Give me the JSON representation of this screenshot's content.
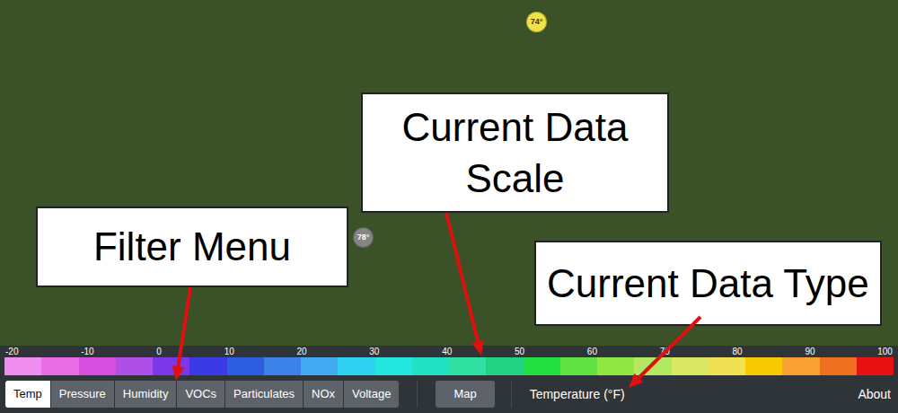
{
  "map": {
    "pins": [
      {
        "label": "74°",
        "color": "#f2e24a"
      },
      {
        "label": "78°",
        "color": "#858585"
      }
    ]
  },
  "annotations": [
    {
      "text": "Filter Menu"
    },
    {
      "text": "Current Data Scale"
    },
    {
      "text": "Current Data Type"
    }
  ],
  "scale": {
    "ticks": [
      "-20",
      "-10",
      "0",
      "10",
      "20",
      "30",
      "40",
      "50",
      "60",
      "70",
      "80",
      "90",
      "100"
    ],
    "segments": [
      {
        "color": "#f08ef0"
      },
      {
        "color": "#e86ee8"
      },
      {
        "color": "#d650e0"
      },
      {
        "color": "#b04ee8"
      },
      {
        "color": "#7a38e8"
      },
      {
        "color": "#3a3ae6"
      },
      {
        "color": "#2e5ee0"
      },
      {
        "color": "#3a82e8"
      },
      {
        "color": "#42aaf0"
      },
      {
        "color": "#30d0f0"
      },
      {
        "color": "#22e8e0"
      },
      {
        "color": "#22e0c2"
      },
      {
        "color": "#30e0a2"
      },
      {
        "color": "#22d282"
      },
      {
        "color": "#22e042"
      },
      {
        "color": "#62e242"
      },
      {
        "color": "#92e842"
      },
      {
        "color": "#b2e862"
      },
      {
        "color": "#d8e862"
      },
      {
        "color": "#f0e052"
      },
      {
        "color": "#f8c802"
      },
      {
        "color": "#f8a032"
      },
      {
        "color": "#f07022"
      },
      {
        "color": "#e81212"
      }
    ]
  },
  "filters": [
    {
      "label": "Temp",
      "selected": true
    },
    {
      "label": "Pressure",
      "selected": false
    },
    {
      "label": "Humidity",
      "selected": false
    },
    {
      "label": "VOCs",
      "selected": false
    },
    {
      "label": "Particulates",
      "selected": false
    },
    {
      "label": "NOx",
      "selected": false
    },
    {
      "label": "Voltage",
      "selected": false
    }
  ],
  "map_button": "Map",
  "data_type": "Temperature (°F)",
  "about": "About"
}
